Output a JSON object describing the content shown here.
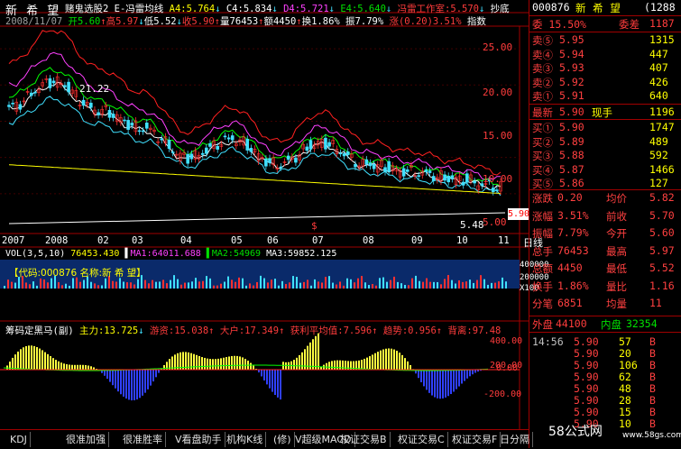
{
  "header": {
    "stock_name": "新 希 望",
    "indicator_line": "赌鬼选股2 E-冯雷均线",
    "a4": "A4:5.764",
    "c4": "C4:5.834",
    "d4": "D4:5.721",
    "e4": "E4:5.640",
    "studio": "冯雷工作室:5.570",
    "chao": "抄底",
    "date": "2008/11/07",
    "open": "开5.60",
    "high": "高5.97",
    "low": "低5.52",
    "close": "收5.90",
    "volume": "量76453",
    "amount": "额4450",
    "turnover": "换1.86%",
    "amplitude": "振7.79%",
    "change": "涨(0.20)3.51%",
    "index_tag": "指数"
  },
  "price_chart": {
    "y_ticks": [
      "25.00",
      "20.00",
      "15.00",
      "10.00",
      "5.00"
    ],
    "x_ticks": [
      "2007",
      "2008",
      "02",
      "03",
      "04",
      "05",
      "06",
      "07",
      "08",
      "09",
      "10",
      "11"
    ],
    "period": "日线",
    "peak_label": "21.22",
    "low_label": "5.48",
    "current_price": "5.90",
    "buy_mark": "$"
  },
  "volume_chart": {
    "title": "VOL(3,5,10)",
    "vol": "76453.430",
    "ma1": "MA1:64011.688",
    "ma2": "MA2:54969",
    "ma3": "MA3:59852.125",
    "banner": "【代码:000876 名称:新 希 望】",
    "y_ticks": [
      "400000",
      "200000",
      "X100"
    ]
  },
  "indicator_chart": {
    "title": "筹码定黑马(副)",
    "main": "主力:13.725",
    "youzi": "游资:15.038",
    "dahu": "大户:17.349",
    "avg": "获利平均值:7.596",
    "trend": "趋势:0.956",
    "divergence": "背离:97.48",
    "y_ticks": [
      "400.00",
      "200.00",
      "0.00",
      "-200.00"
    ]
  },
  "sidebar": {
    "name": "新 希 望",
    "code": "000876",
    "code_suffix": "(1288",
    "weibi": "委 15.50%",
    "weicha": "委差",
    "weicha_val": "1187",
    "asks": [
      {
        "label": "卖⑤",
        "price": "5.95",
        "vol": "1315"
      },
      {
        "label": "卖④",
        "price": "5.94",
        "vol": "447"
      },
      {
        "label": "卖③",
        "price": "5.93",
        "vol": "407"
      },
      {
        "label": "卖②",
        "price": "5.92",
        "vol": "426"
      },
      {
        "label": "卖①",
        "price": "5.91",
        "vol": "640"
      }
    ],
    "latest_label": "最新",
    "latest": "5.90",
    "xianshou_label": "现手",
    "xianshou": "1196",
    "bids": [
      {
        "label": "买①",
        "price": "5.90",
        "vol": "1747"
      },
      {
        "label": "买②",
        "price": "5.89",
        "vol": "489"
      },
      {
        "label": "买③",
        "price": "5.88",
        "vol": "592"
      },
      {
        "label": "买④",
        "price": "5.87",
        "vol": "1466"
      },
      {
        "label": "买⑤",
        "price": "5.86",
        "vol": "127"
      }
    ],
    "stats": [
      {
        "k1": "涨跌",
        "v1": "0.20",
        "k2": "均价",
        "v2": "5.82"
      },
      {
        "k1": "涨幅",
        "v1": "3.51%",
        "k2": "前收",
        "v2": "5.70"
      },
      {
        "k1": "振幅",
        "v1": "7.79%",
        "k2": "今开",
        "v2": "5.60"
      },
      {
        "k1": "总手",
        "v1": "76453",
        "k2": "最高",
        "v2": "5.97"
      },
      {
        "k1": "总额",
        "v1": "4450",
        "k2": "最低",
        "v2": "5.52"
      },
      {
        "k1": "换手",
        "v1": "1.86%",
        "k2": "量比",
        "v2": "1.16"
      },
      {
        "k1": "分笔",
        "v1": "6851",
        "k2": "均量",
        "v2": "11"
      }
    ],
    "outer_label": "外盘",
    "outer": "44100",
    "inner_label": "内盘",
    "inner": "32354",
    "ticks": [
      {
        "time": "14:56",
        "price": "5.90",
        "vol": "57",
        "side": "B"
      },
      {
        "time": "",
        "price": "5.90",
        "vol": "20",
        "side": "B"
      },
      {
        "time": "",
        "price": "5.90",
        "vol": "106",
        "side": "B"
      },
      {
        "time": "",
        "price": "5.90",
        "vol": "62",
        "side": "B"
      },
      {
        "time": "",
        "price": "5.90",
        "vol": "48",
        "side": "B"
      },
      {
        "time": "",
        "price": "5.90",
        "vol": "28",
        "side": "B"
      },
      {
        "time": "",
        "price": "5.90",
        "vol": "15",
        "side": "B"
      },
      {
        "time": "",
        "price": "5.90",
        "vol": "10",
        "side": "B"
      }
    ],
    "watermark1": "58公式网",
    "watermark2": "www.58gs.com"
  },
  "tabs": [
    "KDJ",
    "很准加强",
    "很准胜率",
    "V看盘助手",
    "机构K线",
    "(修)",
    "V超级MACD",
    "权证交易B",
    "权证交易C",
    "权证交易F",
    "日分隔"
  ],
  "chart_data": {
    "type": "line",
    "title": "",
    "xlabel": "",
    "ylabel": "",
    "ylim": [
      0,
      28
    ],
    "x": [
      "2007",
      "2008",
      "02",
      "03",
      "04",
      "05",
      "06",
      "07",
      "08",
      "09",
      "10",
      "11"
    ],
    "series": [
      {
        "values": [
          17.0,
          20.5,
          16.5,
          14.0,
          10.0,
          12.5,
          9.0,
          12.0,
          9.0,
          8.0,
          7.0,
          5.9
        ]
      },
      {
        "values": [
          15.0,
          19.0,
          15.5,
          13.0,
          9.5,
          11.5,
          8.5,
          11.0,
          8.5,
          7.5,
          6.8,
          5.8
        ]
      }
    ]
  }
}
